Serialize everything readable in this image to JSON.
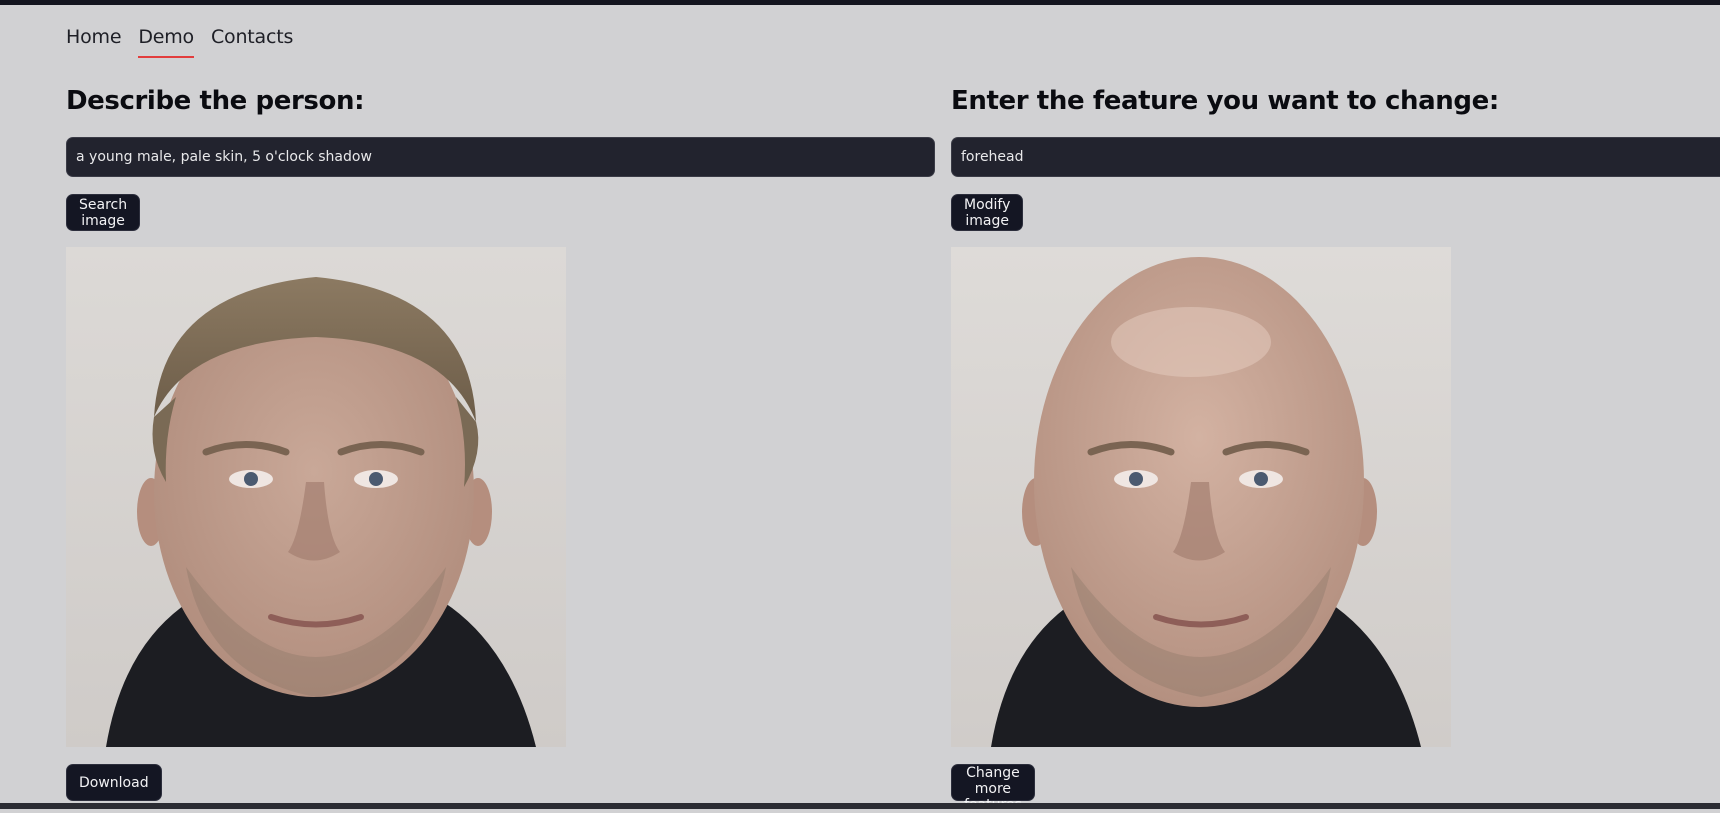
{
  "nav": {
    "items": [
      {
        "label": "Home",
        "active": false
      },
      {
        "label": "Demo",
        "active": true
      },
      {
        "label": "Contacts",
        "active": false
      }
    ],
    "active_color": "#e23d3d"
  },
  "left": {
    "heading": "Describe the person:",
    "input_value": "a young male, pale skin, 5 o'clock shadow",
    "action_button": "Search image",
    "image_alt": "Generated face: man with short brown hair",
    "footer_button": "Download"
  },
  "right": {
    "heading": "Enter the feature you want to change:",
    "input_value": "forehead",
    "action_button": "Modify image",
    "image_alt": "Modified face: same man, bald",
    "footer_button": "Change more features"
  },
  "colors": {
    "background": "#d1d1d3",
    "input_bg": "#22232e",
    "button_bg": "#141623"
  }
}
